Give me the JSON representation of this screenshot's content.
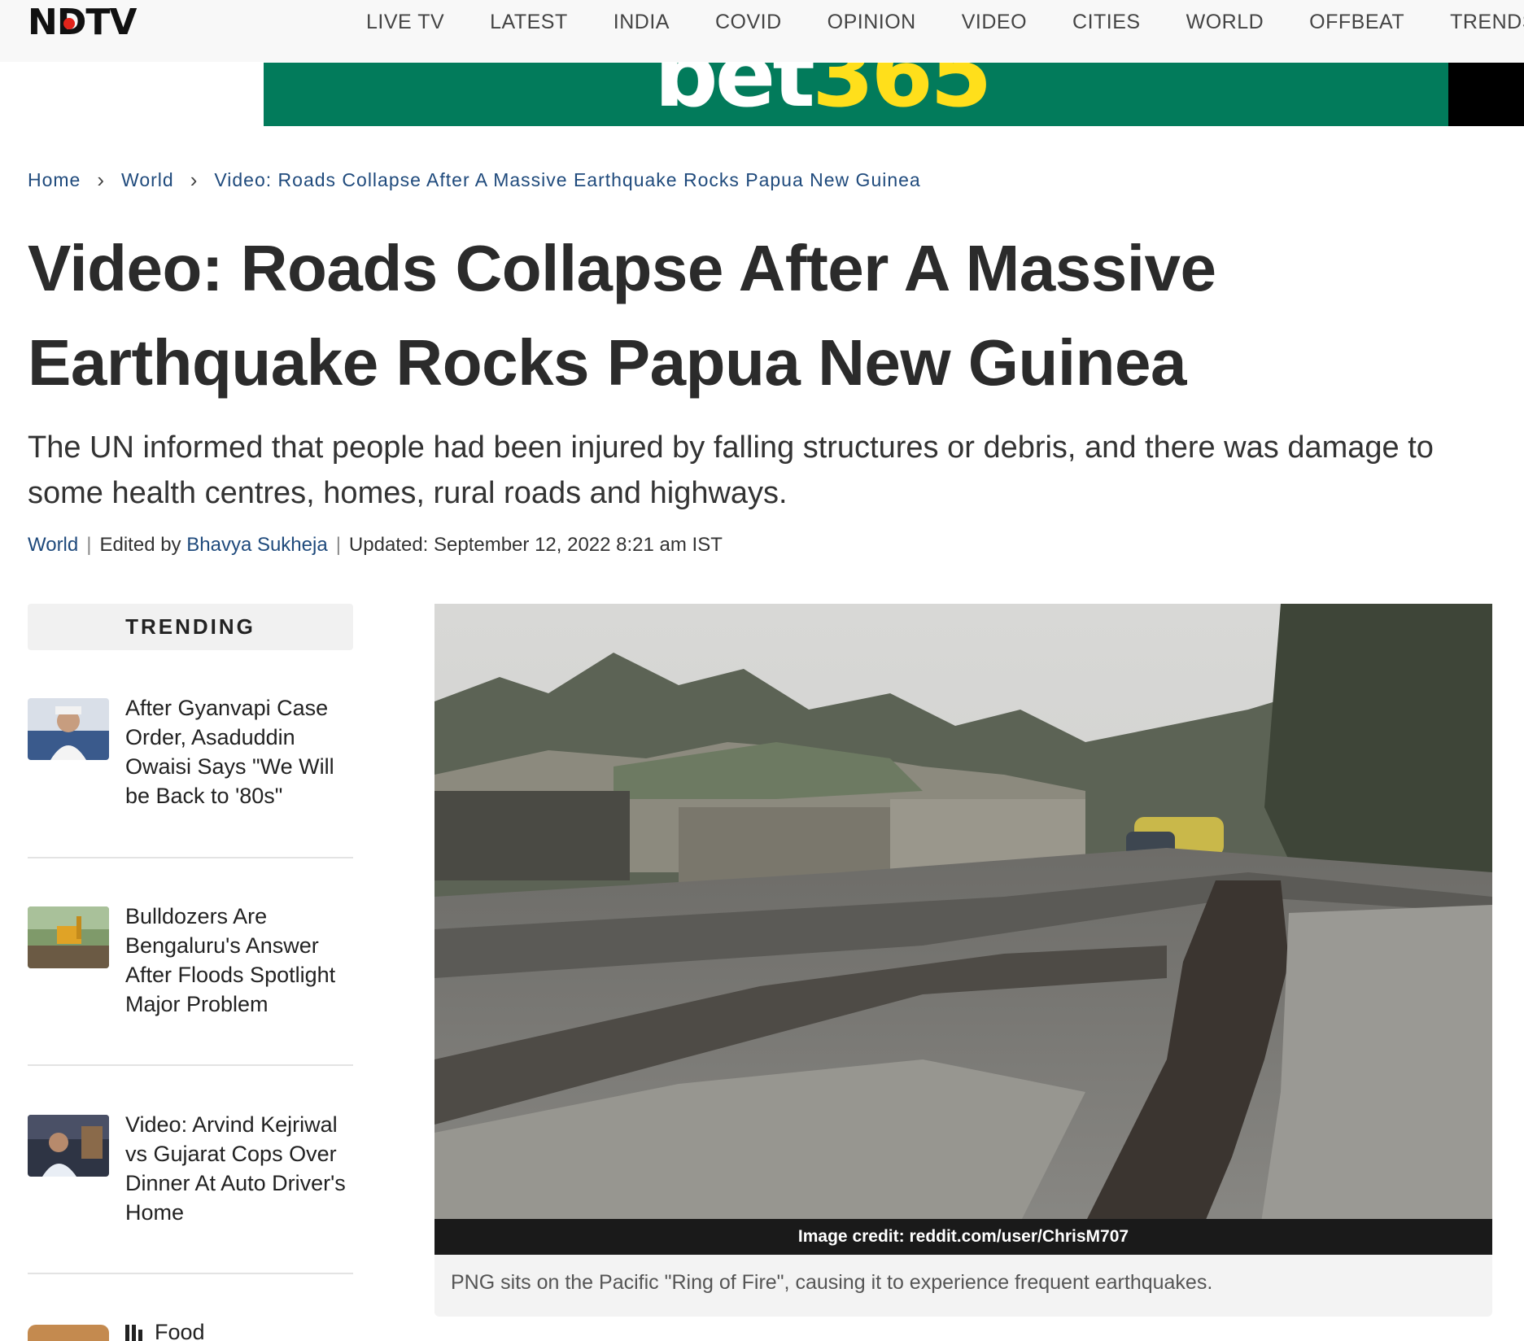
{
  "brand": {
    "logo_text": "NDTV"
  },
  "nav": {
    "items": [
      "LIVE TV",
      "LATEST",
      "INDIA",
      "COVID",
      "OPINION",
      "VIDEO",
      "CITIES",
      "WORLD",
      "OFFBEAT",
      "TRENDS"
    ]
  },
  "ad": {
    "logo_left": "bet",
    "logo_right": "365"
  },
  "breadcrumb": {
    "home": "Home",
    "section": "World",
    "current": "Video: Roads Collapse After A Massive Earthquake Rocks Papua New Guinea"
  },
  "article": {
    "title": "Video: Roads Collapse After A Massive Earthquake Rocks Papua New Guinea",
    "summary": "The UN informed that people had been injured by falling structures or debris, and there was damage to some health centres, homes, rural roads and highways.",
    "category": "World",
    "edited_by_label": "Edited by",
    "editor": "Bhavya Sukheja",
    "updated": "Updated: September 12, 2022 8:21 am IST",
    "image_credit": "Image credit: reddit.com/user/ChrisM707",
    "caption": "PNG sits on the Pacific \"Ring of Fire\", causing it to experience frequent earthquakes."
  },
  "trending": {
    "heading": "TRENDING",
    "items": [
      {
        "title": "After Gyanvapi Case Order, Asaduddin Owaisi Says \"We Will be Back to '80s\""
      },
      {
        "title": "Bulldozers Are Bengaluru's Answer After Floods Spotlight Major Problem"
      },
      {
        "title": "Video: Arvind Kejriwal vs Gujarat Cops Over Dinner At Auto Driver's Home"
      }
    ],
    "next_label": "Food"
  },
  "colors": {
    "link": "#1f4a7c",
    "ad_green": "#027b5b",
    "ad_yellow": "#ffdf1b",
    "logo_red": "#e2241b"
  }
}
